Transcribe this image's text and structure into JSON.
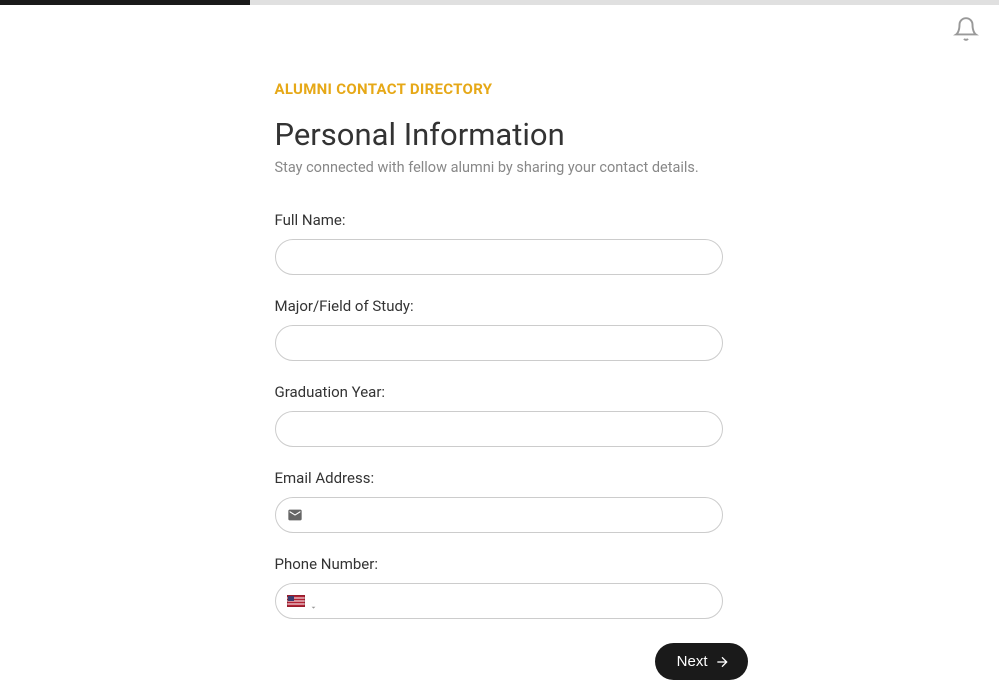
{
  "header": {
    "category": "ALUMNI CONTACT DIRECTORY",
    "title": "Personal Information",
    "subtitle": "Stay connected with fellow alumni by sharing your contact details."
  },
  "fields": {
    "fullName": {
      "label": "Full Name:",
      "value": ""
    },
    "major": {
      "label": "Major/Field of Study:",
      "value": ""
    },
    "gradYear": {
      "label": "Graduation Year:",
      "value": ""
    },
    "email": {
      "label": "Email Address:",
      "value": ""
    },
    "phone": {
      "label": "Phone Number:",
      "value": "",
      "country": "US"
    }
  },
  "buttons": {
    "next": "Next"
  }
}
